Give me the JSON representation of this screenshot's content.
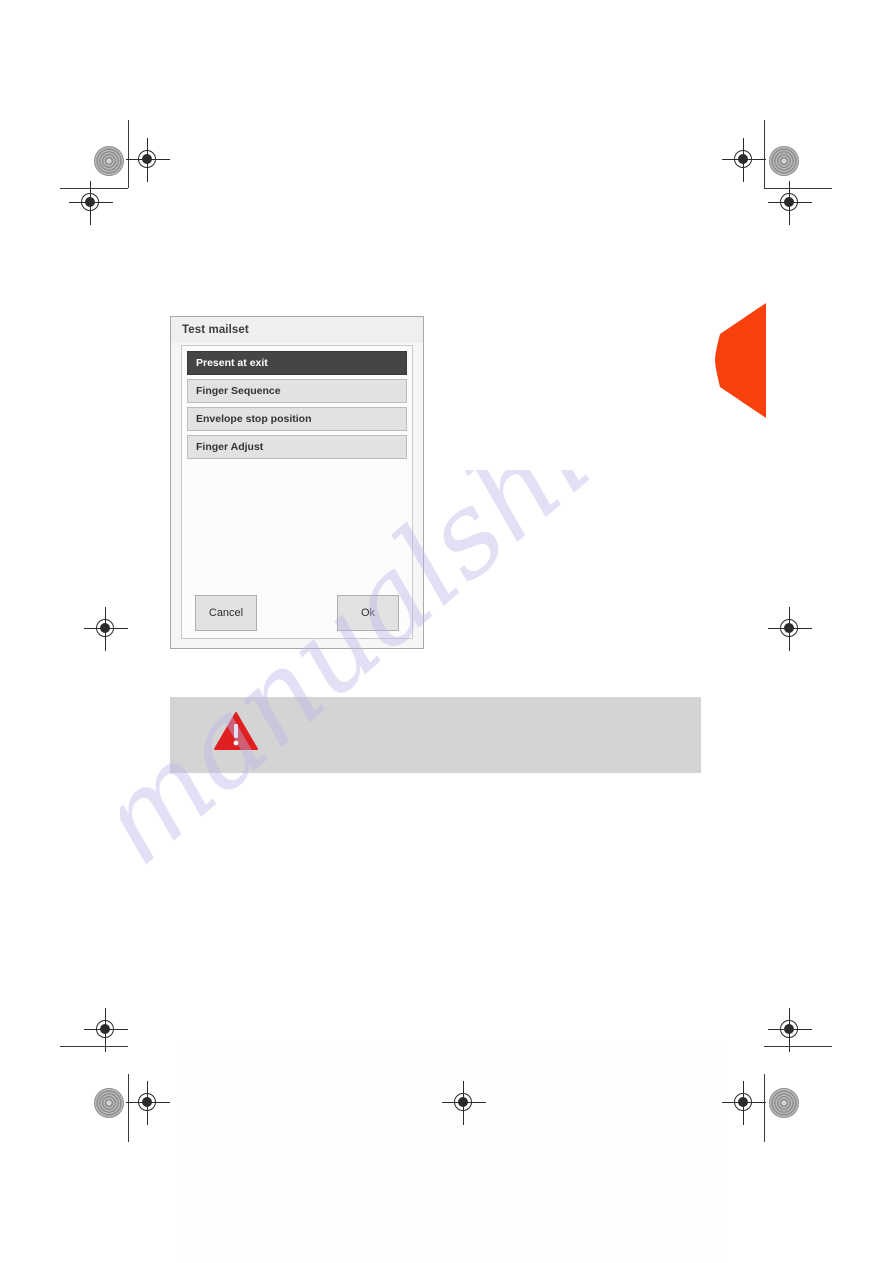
{
  "dialog": {
    "title": "Test mailset",
    "menu_items": [
      {
        "label": "Present at exit",
        "selected": true
      },
      {
        "label": "Finger Sequence",
        "selected": false
      },
      {
        "label": "Envelope stop position",
        "selected": false
      },
      {
        "label": "Finger Adjust",
        "selected": false
      }
    ],
    "cancel_label": "Cancel",
    "ok_label": "Ok"
  },
  "note": {
    "icon": "warning-triangle-icon",
    "text": ""
  },
  "watermark": {
    "text": "manualshive.com"
  },
  "colors": {
    "tab_orange": "#f9410d",
    "selected_row": "#454545",
    "row": "#e2e2e2",
    "note_band": "#d4d4d4",
    "warning_red": "#e02020",
    "watermark": "#b9b7e8"
  },
  "print_marks": {
    "registration_icon": "registration-target-icon",
    "halftone_icon": "halftone-dot-icon",
    "trim_icon": "trim-line-icon"
  }
}
